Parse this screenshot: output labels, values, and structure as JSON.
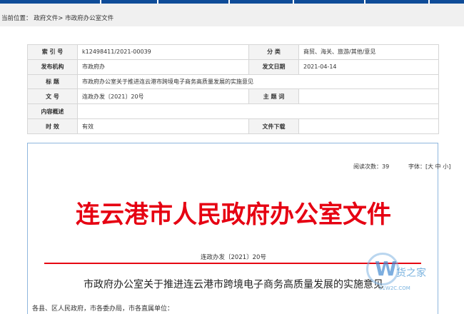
{
  "breadcrumb": {
    "prefix": "当前位置：",
    "items": [
      "政府文件",
      "市政府办公室文件"
    ],
    "separator": ">"
  },
  "meta_table": {
    "rows": [
      [
        {
          "label": "索 引 号",
          "value": "k12498411/2021-00039"
        },
        {
          "label": "分 类",
          "value": "商贸、海关、旅游/其他/意见"
        }
      ],
      [
        {
          "label": "发布机构",
          "value": "市政府办"
        },
        {
          "label": "发文日期",
          "value": "2021-04-14"
        }
      ],
      [
        {
          "label": "标 题",
          "value": "市政府办公室关于推进连云港市跨境电子商务高质量发展的实施意见"
        }
      ],
      [
        {
          "label": "文 号",
          "value": "连政办发〔2021〕20号"
        },
        {
          "label": "主 题 词",
          "value": ""
        }
      ],
      [
        {
          "label": "内容概述",
          "value": ""
        }
      ],
      [
        {
          "label": "时 效",
          "value": "有效"
        },
        {
          "label": "文件下载",
          "value": ""
        }
      ]
    ]
  },
  "doc": {
    "read_label": "阅读次数：",
    "read_count": "39",
    "font_label": "字体：",
    "font_open": "[",
    "font_large": "大",
    "font_medium": "中",
    "font_small": "小",
    "font_close": "]",
    "red_header": "连云港市人民政府办公室文件",
    "doc_number": "连政办发〔2021〕20号",
    "title": "市政府办公室关于推进连云港市跨境电子商务高质量发展的实施意见",
    "body_first_line": "各县、区人民政府，市各委办局，市各直属单位："
  },
  "watermark": {
    "letter": "W",
    "text": "货之家",
    "url": "51W2C.COM"
  },
  "colors": {
    "top_bar": "#0f4c98",
    "red_header": "#e60012",
    "doc_border": "#8fb6dd"
  }
}
